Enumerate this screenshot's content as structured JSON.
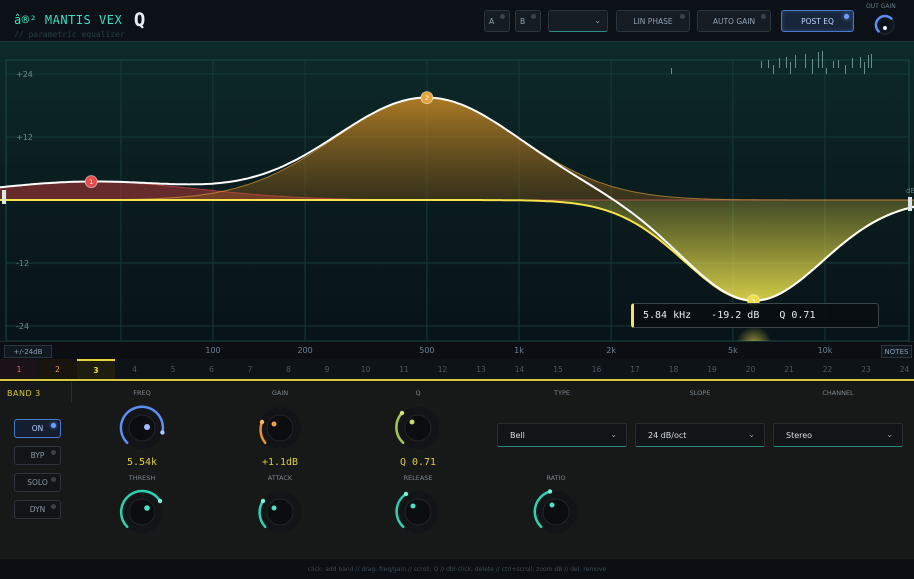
{
  "header": {
    "brand_prefix": "â®²",
    "brand_name": "MANTIS VEX",
    "brand_q": "Q",
    "subtitle": "// parametric equalizer",
    "ab_a": "A",
    "ab_b": "B",
    "preset_value": "",
    "lin_phase": "LIN PHASE",
    "auto_gain": "AUTO GAIN",
    "post_eq": "POST EQ",
    "out_gain_label": "OUT GAIN"
  },
  "graph": {
    "db_labels": [
      "+24",
      "+12",
      "-12",
      "-24"
    ],
    "db_values": [
      24,
      12,
      -12,
      -24
    ],
    "right_edge_label": "dB",
    "bands": [
      {
        "id": "1",
        "color": "#e54b4b",
        "freq_hz": 40,
        "gain_db": 3.5
      },
      {
        "id": "2",
        "color": "#e5a23a",
        "freq_hz": 500,
        "gain_db": 19.5
      },
      {
        "id": "3",
        "color": "#f0df40",
        "freq_hz": 5840,
        "gain_db": -19.2
      }
    ],
    "tooltip": {
      "freq": "5.84 kHz",
      "gain": "-19.2 dB",
      "q": "Q 0.71"
    }
  },
  "axis": {
    "range_button": "+/-24dB",
    "notes_button": "NOTES",
    "freq_labels": [
      "100",
      "200",
      "500",
      "1k",
      "2k",
      "5k",
      "10k"
    ],
    "freq_values": [
      100,
      200,
      500,
      1000,
      2000,
      5000,
      10000
    ]
  },
  "band_tabs": [
    "1",
    "2",
    "3",
    "4",
    "5",
    "6",
    "7",
    "8",
    "9",
    "10",
    "11",
    "12",
    "13",
    "14",
    "15",
    "16",
    "17",
    "18",
    "19",
    "20",
    "21",
    "22",
    "23",
    "24"
  ],
  "band_panel": {
    "title": "BAND 3",
    "buttons": {
      "on": "ON",
      "byp": "BYP",
      "solo": "SOLO",
      "dyn": "DYN"
    },
    "labels": {
      "freq": "FREQ",
      "gain": "GAIN",
      "q": "Q",
      "type": "TYPE",
      "slope": "SLOPE",
      "channel": "CHANNEL",
      "thresh": "THRESH",
      "attack": "ATTACK",
      "release": "RELEASE",
      "ratio": "RATIO"
    },
    "values": {
      "freq": "5.54k",
      "gain": "+1.1dB",
      "q": "Q 0.71"
    },
    "dropdowns": {
      "type": "Bell",
      "slope": "24 dB/oct",
      "channel": "Stereo"
    }
  },
  "footer": {
    "hint": "click: add band  //  drag: freq/gain  //  scroll: Q  //  dbl-click: delete  //  ctrl+scroll: zoom dB  //  del: remove"
  },
  "colors": {
    "accent_teal": "#35e0c3",
    "accent_yellow": "#f0df40",
    "accent_blue": "#6d9dff"
  }
}
